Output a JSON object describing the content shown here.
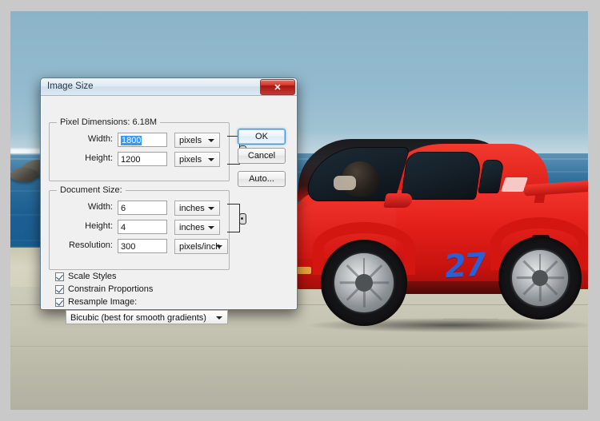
{
  "window": {
    "title": "Image Size",
    "close_label": "✕"
  },
  "pixel_dimensions": {
    "group_label": "Pixel Dimensions:  6.18M",
    "width_label": "Width:",
    "width_value": "1800",
    "width_unit": "pixels",
    "height_label": "Height:",
    "height_value": "1200",
    "height_unit": "pixels"
  },
  "document_size": {
    "group_label": "Document Size:",
    "width_label": "Width:",
    "width_value": "6",
    "width_unit": "inches",
    "height_label": "Height:",
    "height_value": "4",
    "height_unit": "inches",
    "resolution_label": "Resolution:",
    "resolution_value": "300",
    "resolution_unit": "pixels/inch"
  },
  "options": {
    "scale_styles": "Scale Styles",
    "constrain_proportions": "Constrain Proportions",
    "resample_image": "Resample Image:",
    "resample_method": "Bicubic (best for smooth gradients)"
  },
  "buttons": {
    "ok": "OK",
    "cancel": "Cancel",
    "auto": "Auto..."
  },
  "photo": {
    "car_number": "27"
  },
  "colors": {
    "selection_blue": "#3399ff",
    "close_red": "#c33a32",
    "car_red": "#e01b16",
    "number_blue": "#2a5fd6",
    "sky": "#8cb3c7",
    "ocean": "#1d5f92",
    "pavement": "#c6c4b2",
    "canvas_gray": "#c9c9c9"
  }
}
